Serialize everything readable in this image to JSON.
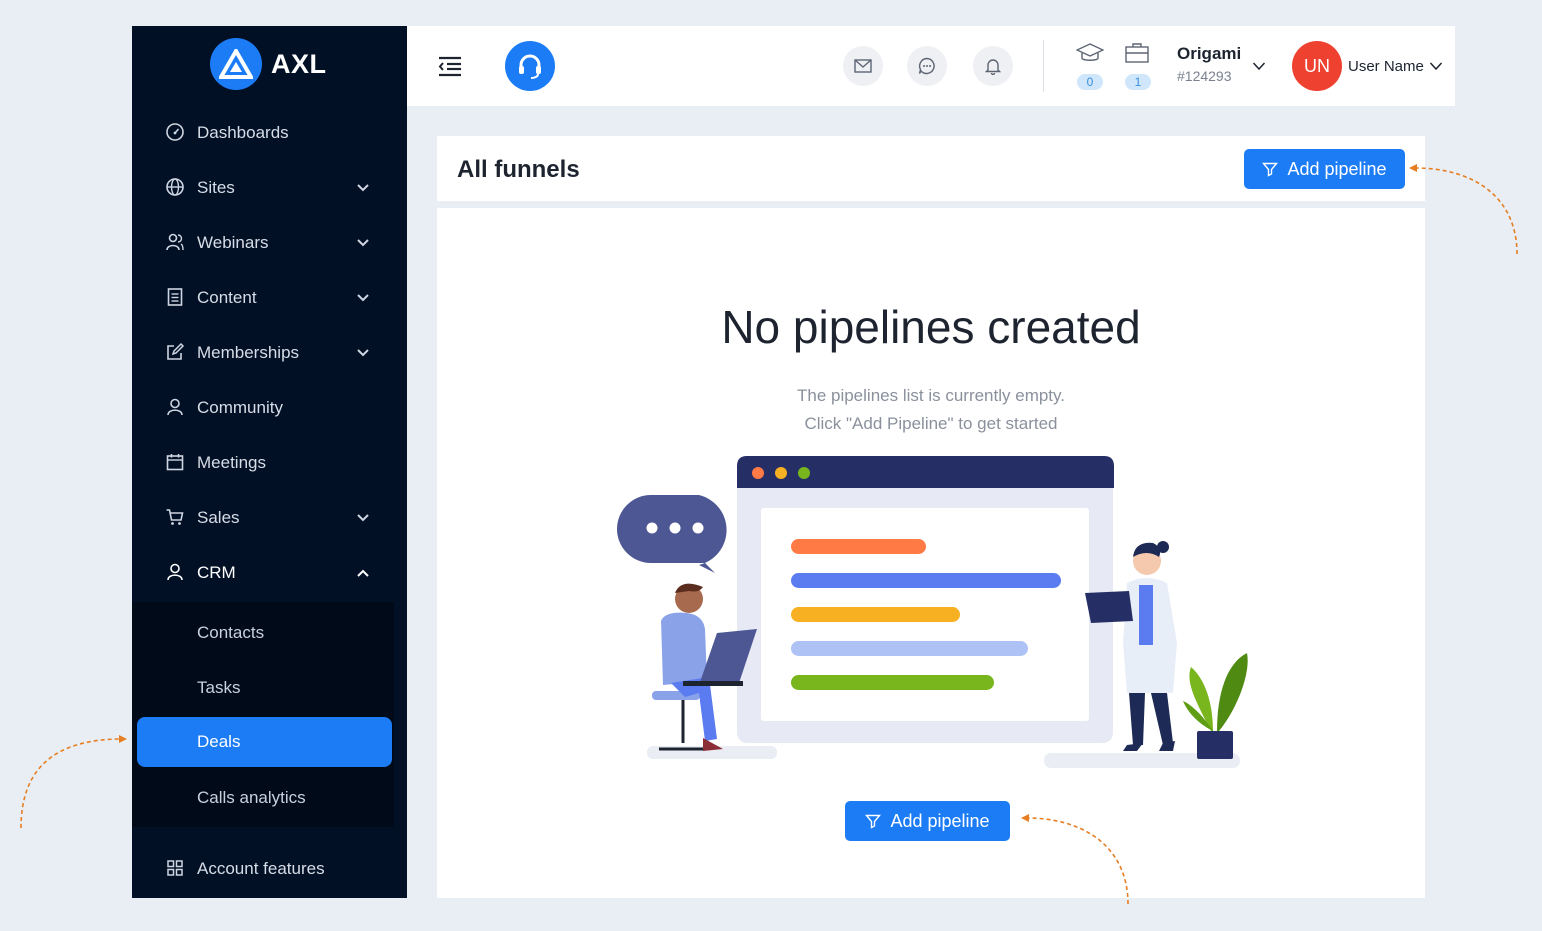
{
  "brand": {
    "name": "AXL"
  },
  "sidebar": {
    "items": [
      {
        "label": "Dashboards",
        "icon": "gauge-icon",
        "expandable": false
      },
      {
        "label": "Sites",
        "icon": "globe-icon",
        "expandable": true
      },
      {
        "label": "Webinars",
        "icon": "users-icon",
        "expandable": true
      },
      {
        "label": "Content",
        "icon": "document-icon",
        "expandable": true
      },
      {
        "label": "Memberships",
        "icon": "edit-icon",
        "expandable": true
      },
      {
        "label": "Community",
        "icon": "user-icon",
        "expandable": false
      },
      {
        "label": "Meetings",
        "icon": "calendar-icon",
        "expandable": false
      },
      {
        "label": "Sales",
        "icon": "cart-icon",
        "expandable": true
      },
      {
        "label": "CRM",
        "icon": "user-icon",
        "expandable": true,
        "expanded": true
      }
    ],
    "crm_submenu": [
      "Contacts",
      "Tasks",
      "Deals",
      "Calls analytics"
    ],
    "active_item": "Deals",
    "footer_item": {
      "label": "Account features",
      "icon": "grid-icon"
    }
  },
  "header": {
    "courses_count": "0",
    "products_count": "1",
    "account_name": "Origami",
    "account_id": "#124293",
    "avatar_initials": "UN",
    "user_name": "User Name"
  },
  "main": {
    "title": "All funnels",
    "add_button_label": "Add pipeline",
    "empty_title": "No pipelines created",
    "empty_line1": "The pipelines list is currently empty.",
    "empty_line2": "Click \"Add Pipeline\" to get started"
  },
  "colors": {
    "accent": "#1b7cf6",
    "sidebar_bg": "#021026",
    "avatar_bg": "#ee4130",
    "annotation_arrow": "#e67e22"
  }
}
